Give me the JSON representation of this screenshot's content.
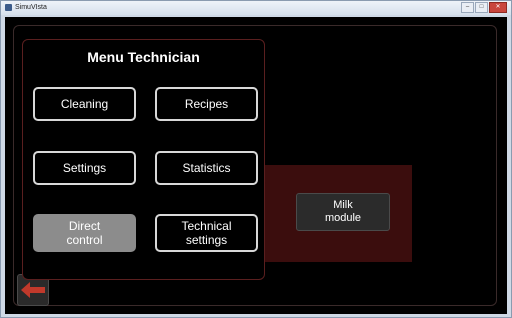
{
  "window": {
    "title": "SimuVIsta",
    "controls": {
      "minimize": "–",
      "maximize": "□",
      "close": "✕"
    }
  },
  "menu": {
    "title": "Menu Technician",
    "buttons": [
      {
        "label": "Cleaning",
        "active": false
      },
      {
        "label": "Recipes",
        "active": false
      },
      {
        "label": "Settings",
        "active": false
      },
      {
        "label": "Statistics",
        "active": false
      },
      {
        "label": "Direct\ncontrol",
        "active": true
      },
      {
        "label": "Technical\nsettings",
        "active": false
      }
    ]
  },
  "submenu": {
    "milk_module_label": "Milk\nmodule"
  },
  "back_button": {
    "icon": "back-arrow-icon"
  },
  "colors": {
    "screen_bg": "#000000",
    "panel_border": "#5a1f1f",
    "submenu_bg": "#3b0d0d",
    "active_button": "#8c8c8c",
    "back_arrow": "#c0392b"
  }
}
